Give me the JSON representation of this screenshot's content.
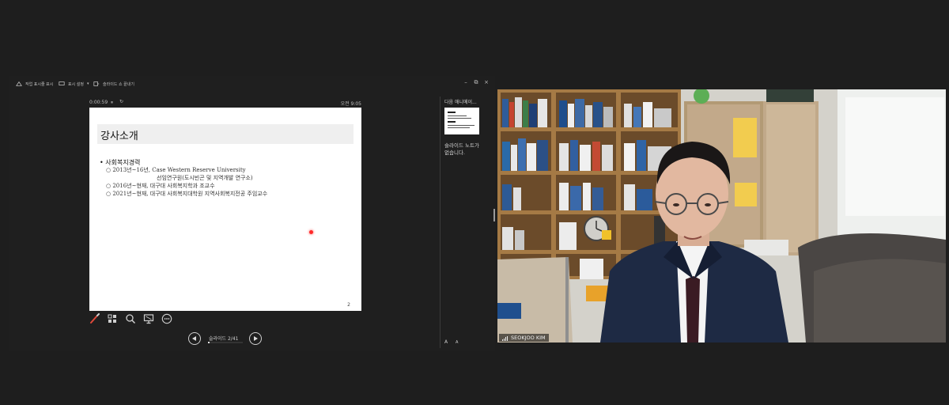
{
  "toolbar": {
    "items": [
      "작업 표시줄 표시",
      "표시 설정",
      "슬라이드 쇼 끝내기"
    ],
    "win_minimize": "–",
    "win_restore": "⧉",
    "win_close": "×"
  },
  "timer": {
    "elapsed": "0:00:59",
    "pause_icon": "⏸",
    "reset_icon": "↻",
    "clock": "오전 9:05"
  },
  "slide": {
    "title": "강사소개",
    "bullet": "• 사회복지경력",
    "sub_items": [
      "○ 2013년~16년, Case Western Reserve University",
      "선임연구원(도시빈곤 및 지역개발 연구소)",
      "○ 2016년~현재,  대구대 사회복지학과 조교수",
      "○ 2021년~현재,  대구대 사회복지대학원 지역사회복지전공 주임교수"
    ],
    "page_number": "2"
  },
  "tools": [
    "pen-icon",
    "grid-icon",
    "magnifier-icon",
    "screen-icon",
    "more-icon"
  ],
  "nav": {
    "counter": "슬라이드 2/41",
    "progress": 0.049
  },
  "side_panel": {
    "next_label": "다음 애니메이...",
    "notes": "슬라이드 노트가 없습니다.",
    "font_larger": "A",
    "font_smaller": "A"
  },
  "video": {
    "participant_name": "SEOKJOO KIM"
  },
  "colors": {
    "background": "#1e1e1e",
    "laser": "#ff2a2a",
    "slide_bg": "#ffffff"
  }
}
